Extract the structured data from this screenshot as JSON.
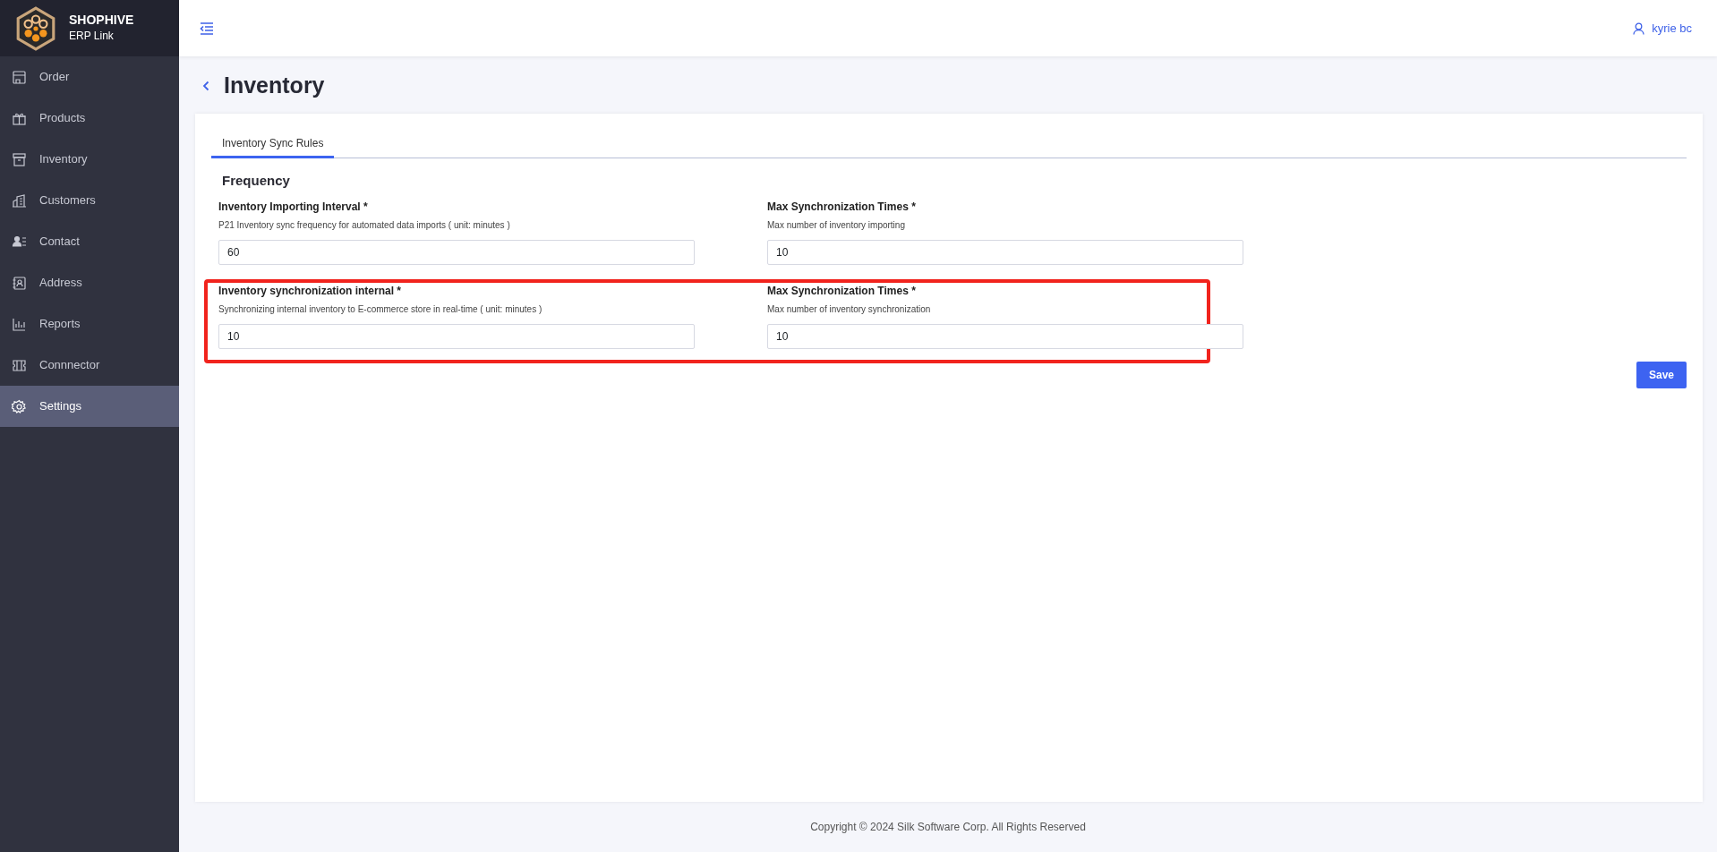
{
  "brand": {
    "name": "SHOPHIVE",
    "subtitle": "ERP Link"
  },
  "sidebar": {
    "items": [
      {
        "label": "Order",
        "selected": false
      },
      {
        "label": "Products",
        "selected": false
      },
      {
        "label": "Inventory",
        "selected": false
      },
      {
        "label": "Customers",
        "selected": false
      },
      {
        "label": "Contact",
        "selected": false
      },
      {
        "label": "Address",
        "selected": false
      },
      {
        "label": "Reports",
        "selected": false
      },
      {
        "label": "Connnector",
        "selected": false
      },
      {
        "label": "Settings",
        "selected": true
      }
    ]
  },
  "header": {
    "user": "kyrie bc"
  },
  "page": {
    "title": "Inventory"
  },
  "tabs": [
    {
      "label": "Inventory Sync Rules",
      "selected": true
    }
  ],
  "section": {
    "title": "Frequency"
  },
  "form_rows": [
    {
      "highlighted": false,
      "fields": [
        {
          "label": "Inventory Importing Interval *",
          "hint": "P21 Inventory sync frequency for automated data imports ( unit: minutes )",
          "value": "60"
        },
        {
          "label": "Max Synchronization Times *",
          "hint": "Max number of inventory importing",
          "value": "10"
        }
      ]
    },
    {
      "highlighted": true,
      "fields": [
        {
          "label": "Inventory synchronization internal *",
          "hint": "Synchronizing internal inventory to E-commerce store in real-time ( unit: minutes )",
          "value": "10"
        },
        {
          "label": "Max Synchronization Times *",
          "hint": "Max number of inventory synchronization",
          "value": "10"
        }
      ]
    }
  ],
  "save_button": "Save",
  "footer": {
    "copyright": "Copyright © 2024 Silk Software Corp. All Rights Reserved"
  }
}
